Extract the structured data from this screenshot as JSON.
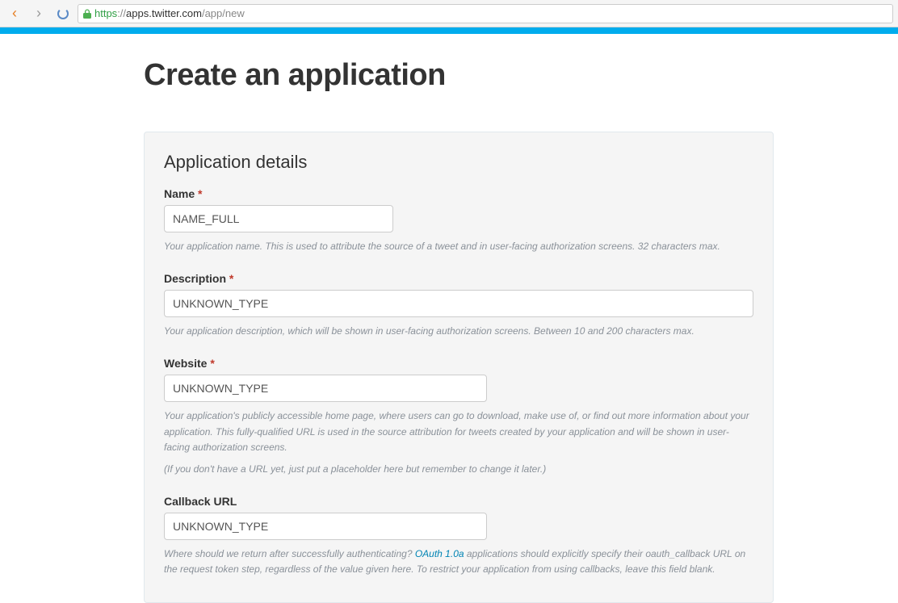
{
  "browser": {
    "url_https": "https",
    "url_sep": "://",
    "url_domain": "apps.twitter.com",
    "url_path": "/app/new"
  },
  "page": {
    "title": "Create an application"
  },
  "panel": {
    "heading": "Application details"
  },
  "fields": {
    "name": {
      "label": "Name",
      "value": "NAME_FULL",
      "help": "Your application name. This is used to attribute the source of a tweet and in user-facing authorization screens. 32 characters max."
    },
    "description": {
      "label": "Description",
      "value": "UNKNOWN_TYPE",
      "help": "Your application description, which will be shown in user-facing authorization screens. Between 10 and 200 characters max."
    },
    "website": {
      "label": "Website",
      "value": "UNKNOWN_TYPE",
      "help1": "Your application's publicly accessible home page, where users can go to download, make use of, or find out more information about your application. This fully-qualified URL is used in the source attribution for tweets created by your application and will be shown in user-facing authorization screens.",
      "help2": "(If you don't have a URL yet, just put a placeholder here but remember to change it later.)"
    },
    "callback": {
      "label": "Callback URL",
      "value": "UNKNOWN_TYPE",
      "help_before": "Where should we return after successfully authenticating? ",
      "help_link": "OAuth 1.0a",
      "help_after": " applications should explicitly specify their oauth_callback URL on the request token step, regardless of the value given here. To restrict your application from using callbacks, leave this field blank."
    }
  },
  "required_mark": "*"
}
